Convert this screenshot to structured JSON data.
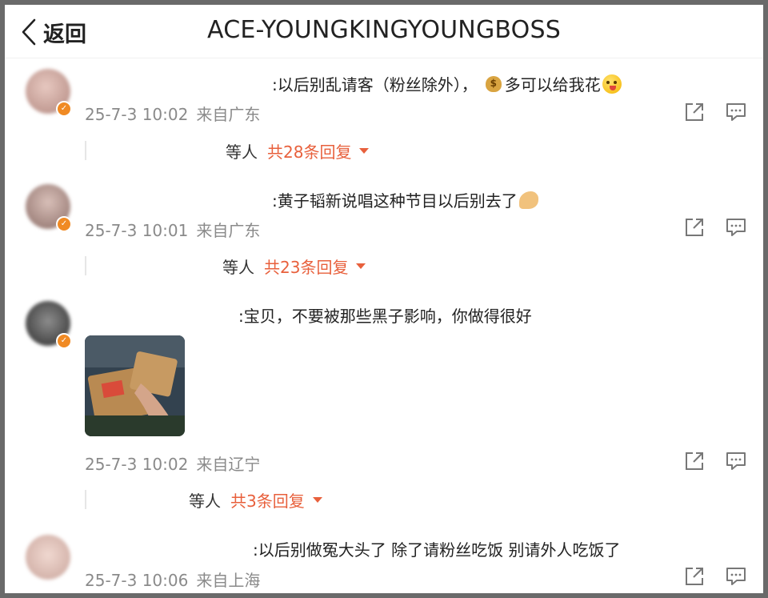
{
  "header": {
    "back_label": "返回",
    "title": "ACE-YOUNGKINGYOUNGBOSS"
  },
  "comments": [
    {
      "text_a": ":以后别乱请客（粉丝除外），",
      "text_b": "多可以给我花",
      "time": "25-7-3 10:02",
      "location": "来自广东",
      "replies_who": "等人",
      "replies_link": "共28条回复"
    },
    {
      "text": ":黄子韬新说唱这种节目以后别去了",
      "time": "25-7-3 10:01",
      "location": "来自广东",
      "replies_who": "等人",
      "replies_link": "共23条回复"
    },
    {
      "text": ":宝贝，不要被那些黑子影响，你做得很好",
      "time": "25-7-3 10:02",
      "location": "来自辽宁",
      "replies_who": "等人",
      "replies_link": "共3条回复"
    },
    {
      "text": ":以后别做冤大头了 除了请粉丝吃饭 别请外人吃饭了",
      "time": "25-7-3 10:06",
      "location": "来自上海"
    }
  ],
  "icons": {
    "share": "share-icon",
    "comment": "comment-icon",
    "back": "chevron-left-icon",
    "caret": "caret-down-icon",
    "verified": "verified-badge-icon",
    "money_bag": "money-bag-emoji",
    "tongue_face": "tongue-face-emoji",
    "muscle": "flexed-biceps-emoji"
  },
  "colors": {
    "reply_link": "#e8603c",
    "meta_gray": "#8a8a8a",
    "verified_orange": "#f08a24"
  }
}
